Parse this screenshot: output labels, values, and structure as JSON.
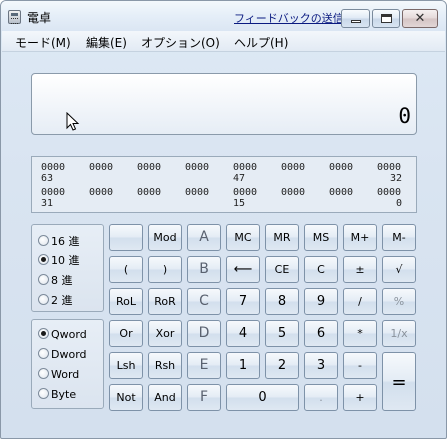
{
  "window": {
    "title": "電卓",
    "feedback_link": "フィードバックの送信",
    "close_glyph": "✕"
  },
  "menu": [
    "モード(M)",
    "編集(E)",
    "オプション(O)",
    "ヘルプ(H)"
  ],
  "display": {
    "value": "0"
  },
  "bits": {
    "groups": [
      "0000",
      "0000",
      "0000",
      "0000",
      "0000",
      "0000",
      "0000",
      "0000",
      "0000",
      "0000",
      "0000",
      "0000",
      "0000",
      "0000",
      "0000",
      "0000"
    ],
    "indices": [
      "63",
      "47",
      "32",
      "31",
      "15",
      "0"
    ]
  },
  "radix": {
    "options": [
      "16 進",
      "10 進",
      "8 進",
      "2 進"
    ],
    "selected": "10 進"
  },
  "word_size": {
    "options": [
      "Qword",
      "Dword",
      "Word",
      "Byte"
    ],
    "selected": "Qword"
  },
  "keys": {
    "blank": "",
    "mod": "Mod",
    "a": "A",
    "mc": "MC",
    "mr": "MR",
    "ms": "MS",
    "mplus": "M+",
    "mminus": "M-",
    "lparen": "(",
    "rparen": ")",
    "b": "B",
    "back": "⟵",
    "ce": "CE",
    "c": "C",
    "plusminus": "±",
    "sqrt": "√",
    "rol": "RoL",
    "ror": "RoR",
    "hc": "C",
    "n7": "7",
    "n8": "8",
    "n9": "9",
    "div": "/",
    "pct": "%",
    "or": "Or",
    "xor": "Xor",
    "d": "D",
    "n4": "4",
    "n5": "5",
    "n6": "6",
    "mul": "*",
    "recip": "1/x",
    "lsh": "Lsh",
    "rsh": "Rsh",
    "e": "E",
    "n1": "1",
    "n2": "2",
    "n3": "3",
    "sub": "-",
    "not": "Not",
    "and": "And",
    "f": "F",
    "n0": "0",
    "dot": ".",
    "add": "+",
    "eq": "="
  }
}
